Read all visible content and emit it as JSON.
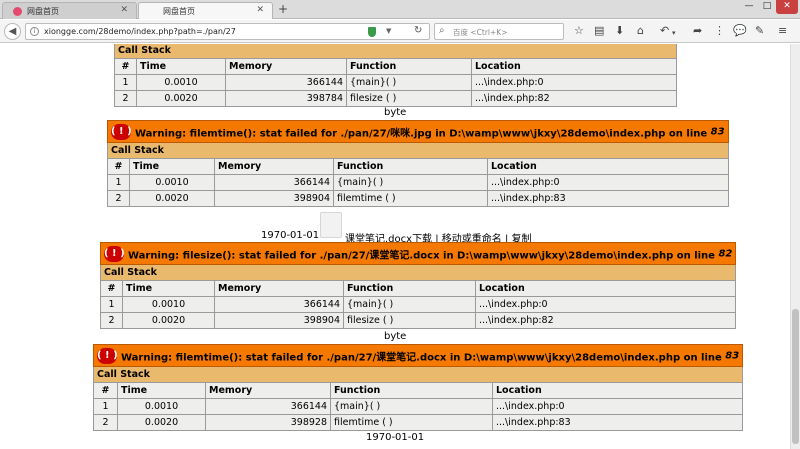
{
  "browser": {
    "tabs": [
      {
        "title": "网盘首页",
        "active": false
      },
      {
        "title": "网盘首页",
        "active": true
      }
    ],
    "newtab": "+",
    "window_controls": {
      "minimize": "—",
      "maximize": "□",
      "close": "✕"
    },
    "url": "xiongge.com/28demo/index.php?path=./pan/27",
    "search_placeholder": "百度 <Ctrl+K>"
  },
  "labels": {
    "call_stack": "Call Stack",
    "col_num": "#",
    "col_time": "Time",
    "col_memory": "Memory",
    "col_function": "Function",
    "col_location": "Location",
    "error_icon": "( ! )"
  },
  "blocks": [
    {
      "rows": [
        {
          "num": "1",
          "time": "0.0010",
          "memory": "366144",
          "function": "{main}( )",
          "location": "...\\index.php:0"
        },
        {
          "num": "2",
          "time": "0.0020",
          "memory": "398784",
          "function": "filesize ( )",
          "location": "...\\index.php:82"
        }
      ]
    },
    {
      "message": "Warning: filemtime(): stat failed for ./pan/27/咪咪.jpg in D:\\wamp\\www\\jkxy\\28demo\\index.php on line ",
      "line": "83",
      "rows": [
        {
          "num": "1",
          "time": "0.0010",
          "memory": "366144",
          "function": "{main}( )",
          "location": "...\\index.php:0"
        },
        {
          "num": "2",
          "time": "0.0020",
          "memory": "398904",
          "function": "filemtime ( )",
          "location": "...\\index.php:83"
        }
      ]
    },
    {
      "message": "Warning: filesize(): stat failed for ./pan/27/课堂笔记.docx in D:\\wamp\\www\\jkxy\\28demo\\index.php on line ",
      "line": "82",
      "rows": [
        {
          "num": "1",
          "time": "0.0010",
          "memory": "366144",
          "function": "{main}( )",
          "location": "...\\index.php:0"
        },
        {
          "num": "2",
          "time": "0.0020",
          "memory": "398904",
          "function": "filesize ( )",
          "location": "...\\index.php:82"
        }
      ]
    },
    {
      "message": "Warning: filemtime(): stat failed for ./pan/27/课堂笔记.docx in D:\\wamp\\www\\jkxy\\28demo\\index.php on line ",
      "line": "83",
      "rows": [
        {
          "num": "1",
          "time": "0.0010",
          "memory": "366144",
          "function": "{main}( )",
          "location": "...\\index.php:0"
        },
        {
          "num": "2",
          "time": "0.0020",
          "memory": "398928",
          "function": "filemtime ( )",
          "location": "...\\index.php:83"
        }
      ]
    }
  ],
  "text": {
    "byte_1": "byte",
    "date_1": "1970-01-01",
    "file_name": "课堂笔记.docx",
    "download": "下载",
    "sep1": " | ",
    "move_rename": "移动或重命名",
    "sep2": " | ",
    "copy": "复制",
    "byte_2": "byte",
    "date_2": "1970-01-01"
  },
  "colors": {
    "warning_bg": "#f57900",
    "call_stack_bg": "#e9b96e",
    "cell_bg": "#eeeeec",
    "error_icon_bg": "#cc0000"
  }
}
